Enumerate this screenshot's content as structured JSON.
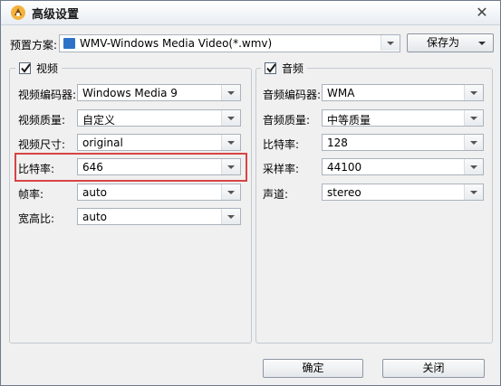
{
  "window": {
    "title": "高级设置",
    "close_glyph": "✕"
  },
  "preset": {
    "label": "预置方案:",
    "value": "WMV-Windows Media Video(*.wmv)",
    "save_as_label": "保存为"
  },
  "video": {
    "enabled": true,
    "title": "视频",
    "rows": [
      {
        "label": "视频编码器:",
        "value": "Windows Media 9"
      },
      {
        "label": "视频质量:",
        "value": "自定义"
      },
      {
        "label": "视频尺寸:",
        "value": "original"
      },
      {
        "label": "比特率:",
        "value": "646"
      },
      {
        "label": "帧率:",
        "value": "auto"
      },
      {
        "label": "宽高比:",
        "value": "auto"
      }
    ]
  },
  "audio": {
    "enabled": true,
    "title": "音频",
    "rows": [
      {
        "label": "音频编码器:",
        "value": "WMA"
      },
      {
        "label": "音频质量:",
        "value": "中等质量"
      },
      {
        "label": "比特率:",
        "value": "128"
      },
      {
        "label": "采样率:",
        "value": "44100"
      },
      {
        "label": "声道:",
        "value": "stereo"
      }
    ]
  },
  "buttons": {
    "ok_label": "确定",
    "close_label": "关闭"
  },
  "colors": {
    "highlight": "#d84444",
    "accent": "#1f6fc5"
  }
}
